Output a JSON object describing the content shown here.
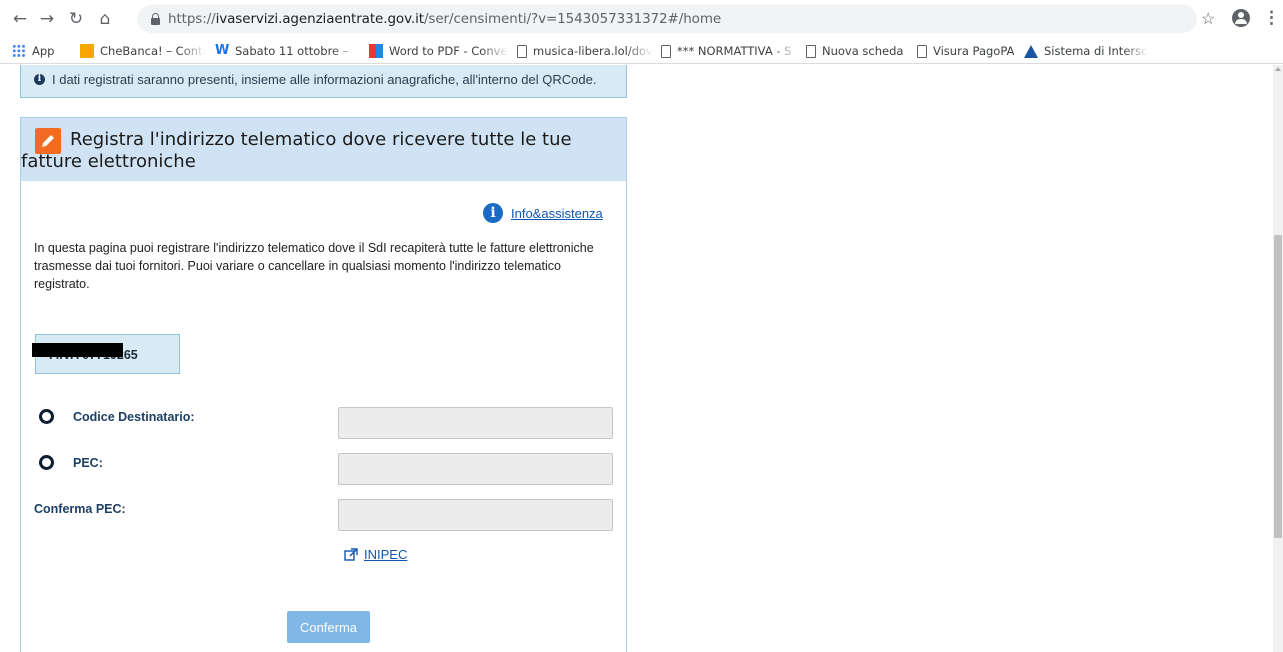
{
  "browser": {
    "url_prefix": "https://",
    "url_domain": "ivaservizi.agenziaentrate.gov.it",
    "url_path": "/ser/censimenti/?v=1543057331372#/home",
    "nav_icons": [
      "back-icon",
      "forward-icon",
      "reload-icon",
      "home-icon",
      "lock-icon",
      "star-icon",
      "account-icon",
      "menu-icon"
    ],
    "bookmarks": [
      {
        "label": "App",
        "icon": "apps-grid-icon"
      },
      {
        "label": "CheBanca! – Conto C",
        "icon": "chebanca-icon"
      },
      {
        "label": "Sabato 11 ottobre –",
        "icon": "w-icon"
      },
      {
        "label": "Word to PDF - Conve",
        "icon": "pdf-icon"
      },
      {
        "label": "musica-libera.lol/dov",
        "icon": "page-icon"
      },
      {
        "label": "*** NORMATTIVA - S",
        "icon": "page-icon"
      },
      {
        "label": "Nuova scheda",
        "icon": "page-icon"
      },
      {
        "label": "Visura PagoPA",
        "icon": "page-icon"
      },
      {
        "label": "Sistema di Interscam",
        "icon": "triangle-icon"
      }
    ]
  },
  "notice": {
    "icon": "info-icon",
    "text": "I dati registrati saranno presenti, insieme alle informazioni anagrafiche, all'interno del QRCode."
  },
  "panel": {
    "icon": "pencil-icon",
    "title": "Registra l'indirizzo telematico dove ricevere tutte le tue fatture elettroniche",
    "help_link": "Info&assistenza",
    "description": "In questa pagina puoi registrare l'indirizzo telematico dove il SdI recapiterà tutte le fatture elettroniche trasmesse dai tuoi fornitori. Puoi variare o cancellare in qualsiasi momento l'indirizzo telematico registrato.",
    "piva_label": "P.IVA 0",
    "piva_visible": "7710265",
    "codice_label": "Codice Destinatario:",
    "pec_label": "PEC:",
    "conferma_pec_label": "Conferma PEC:",
    "codice_value": "",
    "pec_value": "",
    "conferma_pec_value": "",
    "inipec_link": "INIPEC",
    "confirm_button": "Conferma"
  },
  "colors": {
    "accent": "#7fb8e6",
    "header_bg": "#cfe3f5",
    "notice_bg": "#d8ebf5",
    "pencil": "#f26b21",
    "link": "#0f56b3"
  }
}
